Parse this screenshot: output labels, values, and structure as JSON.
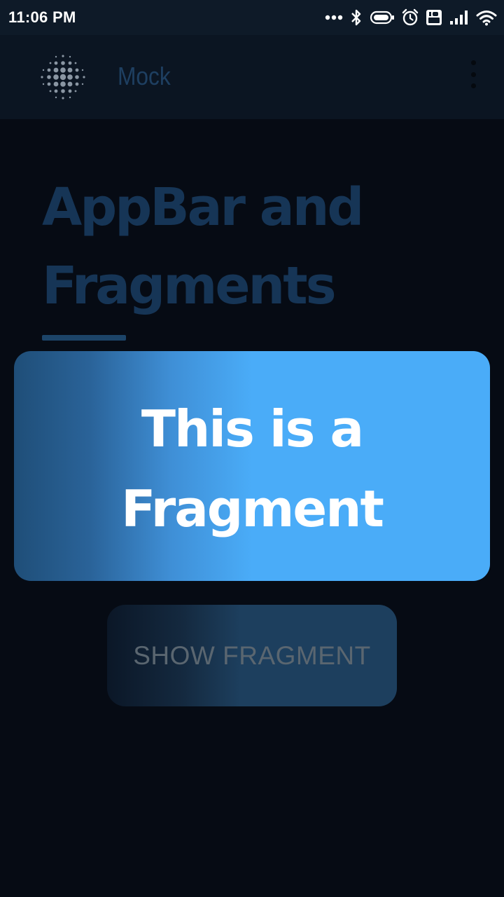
{
  "status_bar": {
    "time": "11:06 PM",
    "icons": [
      "more-dots-icon",
      "bluetooth-icon",
      "battery-icon",
      "alarm-icon",
      "volte-icon",
      "signal-icon",
      "wifi-icon"
    ]
  },
  "app_bar": {
    "title": "Mock",
    "logo_icon": "dotted-circle-logo-icon",
    "menu_icon": "overflow-menu-icon"
  },
  "main": {
    "headline_line1": "AppBar and",
    "headline_line2": "Fragments"
  },
  "fragment": {
    "line1": "This is a",
    "line2": "Fragment"
  },
  "show_fragment_button": {
    "label": "SHOW FRAGMENT"
  },
  "colors": {
    "background": "#060b14",
    "app_bar": "#0b1522",
    "headline": "#163556",
    "fragment_accent": "#4aacf8"
  }
}
